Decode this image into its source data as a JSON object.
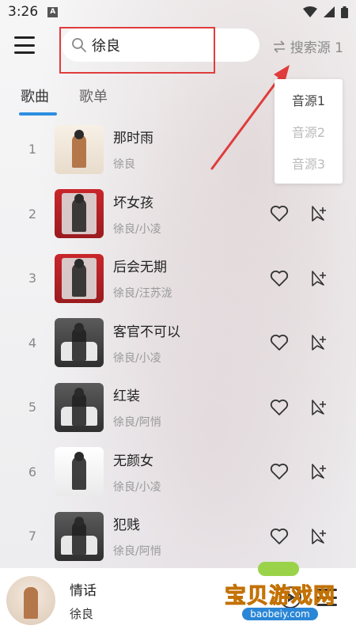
{
  "status_bar": {
    "time": "3:26",
    "notification_icon": "A"
  },
  "search": {
    "query": "徐良"
  },
  "source_switch": {
    "label": "搜索源 1"
  },
  "tabs": [
    {
      "label": "歌曲",
      "active": true
    },
    {
      "label": "歌单",
      "active": false
    }
  ],
  "source_dropdown": {
    "options": [
      "音源1",
      "音源2",
      "音源3"
    ],
    "selected": "音源1"
  },
  "songs": [
    {
      "index": "1",
      "title": "那时雨",
      "artist": "徐良"
    },
    {
      "index": "2",
      "title": "坏女孩",
      "artist": "徐良/小凌"
    },
    {
      "index": "3",
      "title": "后会无期",
      "artist": "徐良/汪苏泷"
    },
    {
      "index": "4",
      "title": "客官不可以",
      "artist": "徐良/小凌"
    },
    {
      "index": "5",
      "title": "红装",
      "artist": "徐良/阿悄"
    },
    {
      "index": "6",
      "title": "无颜女",
      "artist": "徐良/小凌"
    },
    {
      "index": "7",
      "title": "犯贱",
      "artist": "徐良/阿悄"
    }
  ],
  "player": {
    "title": "情话",
    "artist": "徐良"
  },
  "watermark": {
    "title": "宝贝游戏网",
    "url": "baobeiy.com"
  },
  "colors": {
    "accent": "#2e8fe0",
    "highlight_box": "#e03c3c",
    "arrow": "#e03c3c"
  }
}
